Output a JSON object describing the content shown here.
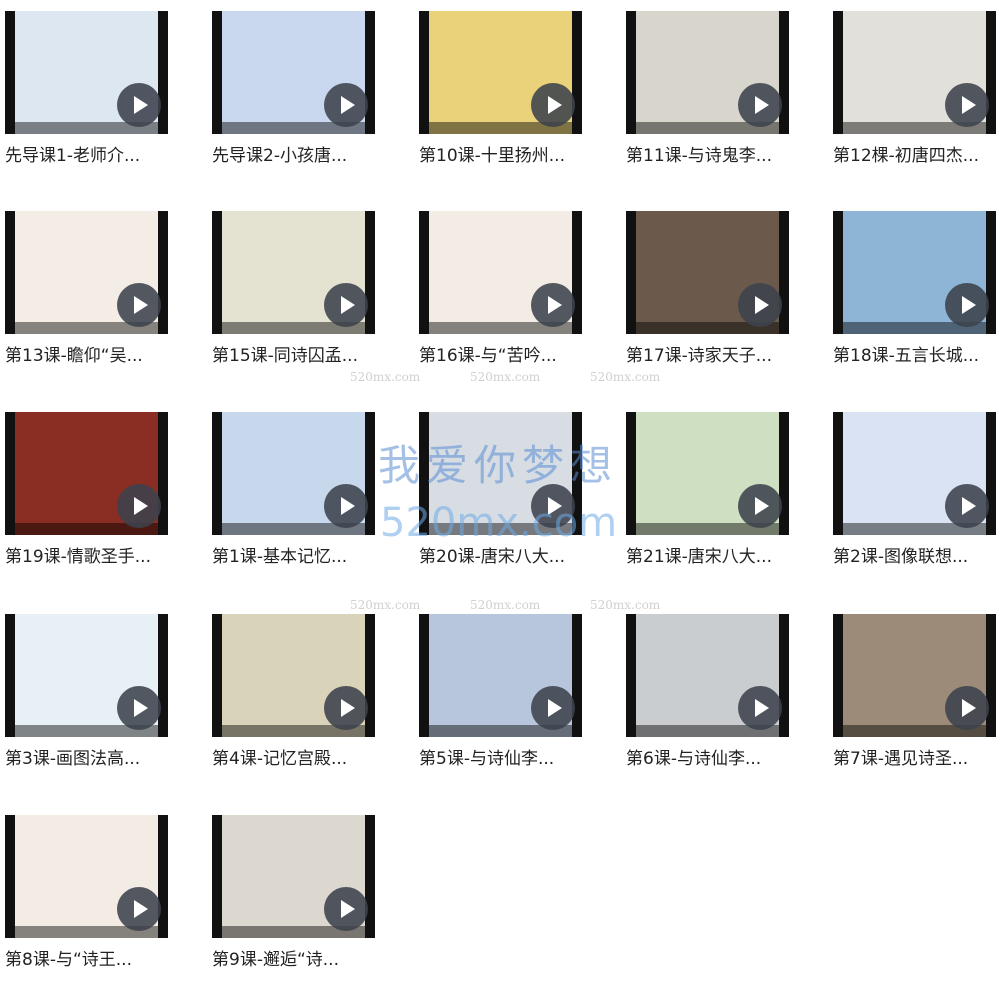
{
  "videos": [
    {
      "title": "先导课1-老师介...",
      "bg": "#dde7f2"
    },
    {
      "title": "先导课2-小孩唐...",
      "bg": "#c9d8ee"
    },
    {
      "title": "第10课-十里扬州...",
      "bg": "#e9d27a"
    },
    {
      "title": "第11课-与诗鬼李...",
      "bg": "#d8d6cc"
    },
    {
      "title": "第12棵-初唐四杰...",
      "bg": "#e2e0da"
    },
    {
      "title": "第13课-瞻仰“吴...",
      "bg": "#f4ede6"
    },
    {
      "title": "第15课-同诗囚孟...",
      "bg": "#e4e2d0"
    },
    {
      "title": "第16课-与“苦吟...",
      "bg": "#f3ece4"
    },
    {
      "title": "第17课-诗家天子...",
      "bg": "#6b5a4c"
    },
    {
      "title": "第18课-五言长城...",
      "bg": "#8fb5d6"
    },
    {
      "title": "第19课-情歌圣手...",
      "bg": "#8a2d22"
    },
    {
      "title": "第1课-基本记忆...",
      "bg": "#c7d8ec"
    },
    {
      "title": "第20课-唐宋八大...",
      "bg": "#d8dde4"
    },
    {
      "title": "第21课-唐宋八大...",
      "bg": "#cfe0c2"
    },
    {
      "title": "第2课-图像联想...",
      "bg": "#d9e3f3"
    },
    {
      "title": "第3课-画图法高...",
      "bg": "#e7f0f4"
    },
    {
      "title": "第4课-记忆宫殿...",
      "bg": "#d9d3b9"
    },
    {
      "title": "第5课-与诗仙李...",
      "bg": "#b8c6dd"
    },
    {
      "title": "第6课-与诗仙李...",
      "bg": "#c9cdd0"
    },
    {
      "title": "第7课-遇见诗圣...",
      "bg": "#9c8b78"
    },
    {
      "title": "第8课-与“诗王...",
      "bg": "#f3ece4"
    },
    {
      "title": "第9课-邂逅“诗...",
      "bg": "#dcd8d0"
    }
  ],
  "watermark": {
    "brand": "我爱你梦想",
    "url": "520mx.com",
    "small": "520mx.com"
  }
}
